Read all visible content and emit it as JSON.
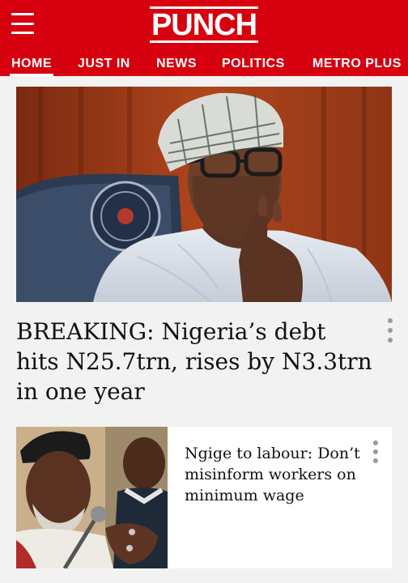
{
  "brand": {
    "logo_text": "PUNCH",
    "color": "#d6000f"
  },
  "nav": {
    "items": [
      {
        "label": "HOME",
        "active": true
      },
      {
        "label": "JUST IN",
        "active": false
      },
      {
        "label": "NEWS",
        "active": false
      },
      {
        "label": "POLITICS",
        "active": false
      },
      {
        "label": "METRO PLUS",
        "active": false
      }
    ]
  },
  "hero": {
    "headline": "BREAKING: Nigeria’s debt hits N25.7trn, rises by N3.3trn in one year",
    "image": "president-photo"
  },
  "stories": [
    {
      "headline": "Ngige to labour: Don’t misinform workers on minimum wage",
      "image": "minister-photo"
    }
  ],
  "icons": {
    "menu": "hamburger-menu-icon",
    "more": "more-options-icon"
  }
}
